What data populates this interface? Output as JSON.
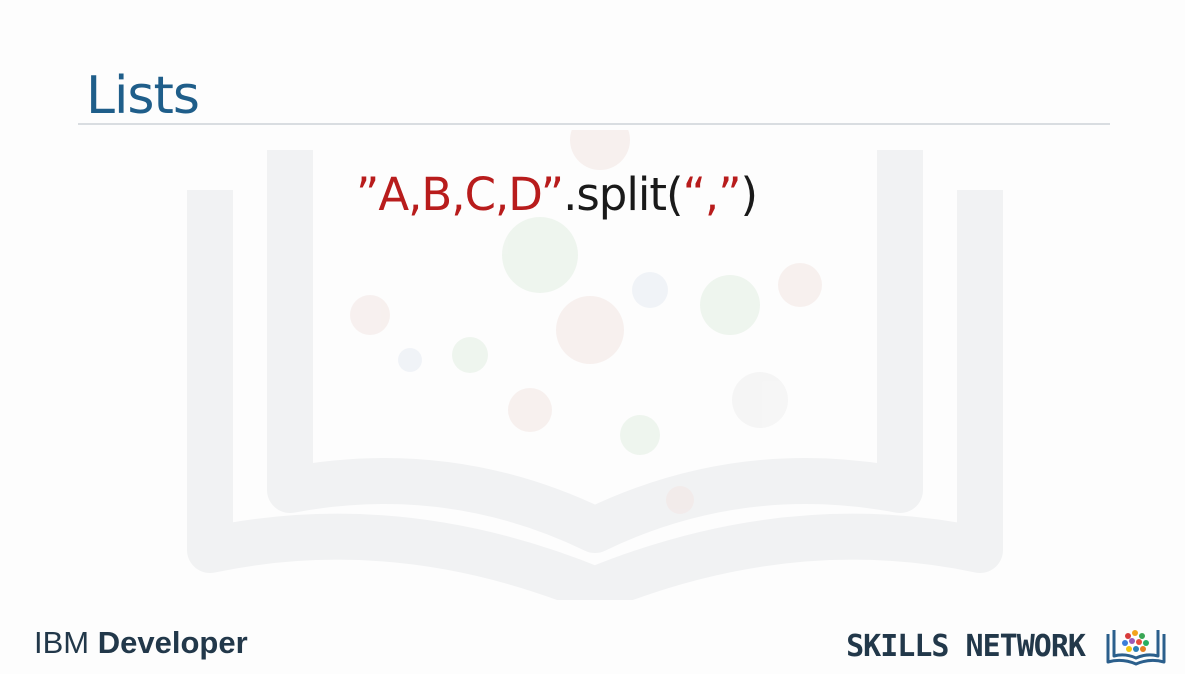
{
  "slide": {
    "title": "Lists",
    "code": {
      "string_part": "”A,B,C,D”",
      "method_part": ".split(",
      "arg_part": "“,”",
      "close_part": ")"
    }
  },
  "footer": {
    "brand": "IBM",
    "product": "Developer",
    "network_label": "SKILLS NETWORK",
    "logo_icon": "skills-network-book-icon"
  },
  "colors": {
    "title": "#1f5e8a",
    "string_red": "#b81c1c",
    "code_dark": "#1a1a1a",
    "footer_text": "#22384a"
  }
}
